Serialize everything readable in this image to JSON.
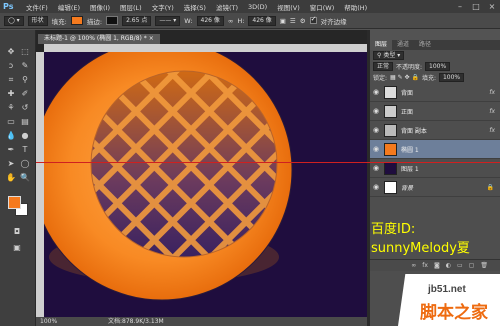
{
  "menubar": {
    "app_logo": "Ps",
    "items": [
      "文件(F)",
      "编辑(E)",
      "图像(I)",
      "图层(L)",
      "文字(Y)",
      "选择(S)",
      "滤镜(T)",
      "3D(D)",
      "视图(V)",
      "窗口(W)",
      "帮助(H)"
    ]
  },
  "options": {
    "mode": "形状",
    "fill_label": "填充:",
    "stroke_label": "描边:",
    "stroke_width": "2.65 点",
    "w_label": "W:",
    "w_value": "426 像",
    "h_label": "H:",
    "h_value": "426 像",
    "align_edges": "对齐边缘",
    "fill_color": "#f57a1e",
    "stroke_color": "#111111"
  },
  "document": {
    "tab_title": "未标题-1 @ 100% (椭圆 1, RGB/8) *",
    "zoom": "100%",
    "doc_info": "文档:878.9K/3.13M"
  },
  "layers_panel": {
    "tabs": [
      "图层",
      "通道",
      "路径"
    ],
    "filter_label": "类型",
    "blend_mode": "正常",
    "opacity_label": "不透明度:",
    "opacity_value": "100%",
    "lock_label": "锁定:",
    "fill_label": "填充:",
    "fill_value": "100%",
    "layers": [
      {
        "name": "背面",
        "fx": "fx"
      },
      {
        "name": "正面",
        "fx": "fx"
      },
      {
        "name": "背面 副本",
        "fx": "fx"
      },
      {
        "name": "椭圆 1",
        "fx": ""
      },
      {
        "name": "图层 1",
        "fx": ""
      },
      {
        "name": "背景",
        "fx": ""
      }
    ]
  },
  "watermark": {
    "id_line": "百度ID:",
    "name_line": "sunnyMelody夏"
  },
  "site_stamp": {
    "url": "jb51.net",
    "name": "脚本之家"
  },
  "colors": {
    "accent_orange": "#f57a1e",
    "canvas_bg": "#1f0d3e",
    "guide_red": "#d02020"
  }
}
